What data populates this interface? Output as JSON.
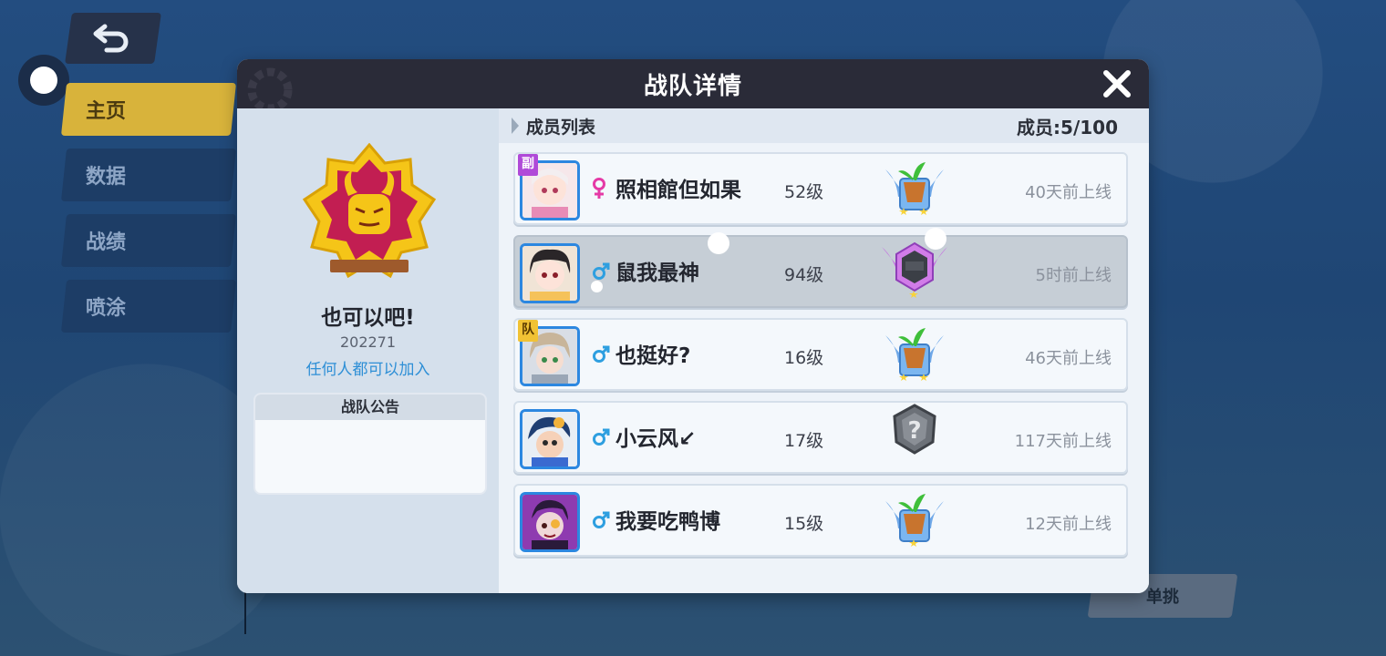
{
  "nav": {
    "tabs": [
      {
        "label": "主页",
        "active": true
      },
      {
        "label": "数据",
        "active": false
      },
      {
        "label": "战绩",
        "active": false
      },
      {
        "label": "喷涂",
        "active": false
      }
    ],
    "solo_button": "单挑"
  },
  "dialog": {
    "title": "战队详情"
  },
  "team": {
    "name": "也可以吧!",
    "id": "202271",
    "join_policy": "任何人都可以加入",
    "notice_title": "战队公告",
    "notice_body": ""
  },
  "members_panel": {
    "title": "成员列表",
    "count_label": "成员:5/100",
    "members": [
      {
        "name": "照相館但如果",
        "level": "52级",
        "last_online": "40天前上线",
        "gender": "female",
        "role_badge": "副",
        "rank_icon": "potted-plant-rank-icon",
        "stars": 2
      },
      {
        "name": "鼠我最神",
        "level": "94级",
        "last_online": "5时前上线",
        "gender": "male",
        "role_badge": "",
        "rank_icon": "purple-crown-rank-icon",
        "stars": 1
      },
      {
        "name": "也挺好?",
        "level": "16级",
        "last_online": "46天前上线",
        "gender": "male",
        "role_badge": "队",
        "rank_icon": "potted-plant-rank-icon",
        "stars": 2
      },
      {
        "name": "小云风↙",
        "level": "17级",
        "last_online": "117天前上线",
        "gender": "male",
        "role_badge": "",
        "rank_icon": "unranked-shield-icon",
        "stars": 0
      },
      {
        "name": "我要吃鸭博",
        "level": "15级",
        "last_online": "12天前上线",
        "gender": "male",
        "role_badge": "",
        "rank_icon": "potted-plant-rank-icon",
        "stars": 1
      }
    ]
  },
  "colors": {
    "accent_gold": "#d8b33b",
    "link_blue": "#2e8fd6",
    "female_pink": "#e53aa6",
    "male_blue": "#2e9fe0"
  }
}
